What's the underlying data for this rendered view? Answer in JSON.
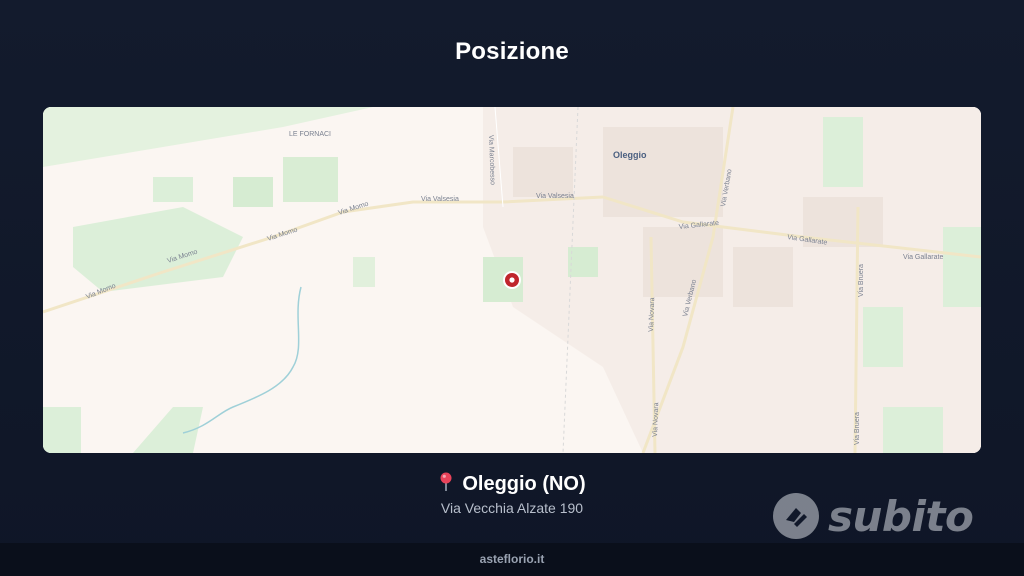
{
  "page": {
    "title": "Posizione"
  },
  "map": {
    "town_label": "Oleggio",
    "locality_label": "LE FORNACI",
    "streets": [
      "Via Valsesia",
      "Via Valsesia",
      "Via Momo",
      "Via Momo",
      "Via Momo",
      "Via Momo",
      "Via Gallarate",
      "Via Gallarate",
      "Via Gallarate",
      "Via Verbano",
      "Via Verbano",
      "Via Novara",
      "Via Novara",
      "Via Bruera",
      "Via Bruera",
      "Via Marcobesso"
    ],
    "colors": {
      "background": "#fbf6f2",
      "green": "#dcefd9",
      "road": "#f3e9c4",
      "marker": "#c0262d"
    }
  },
  "location": {
    "pin_icon": "round-pushpin-icon",
    "city": "Oleggio (NO)",
    "address": "Via Vecchia Alzate 190"
  },
  "watermark": {
    "text": "subito"
  },
  "footer": {
    "text": "asteflorio.it"
  }
}
